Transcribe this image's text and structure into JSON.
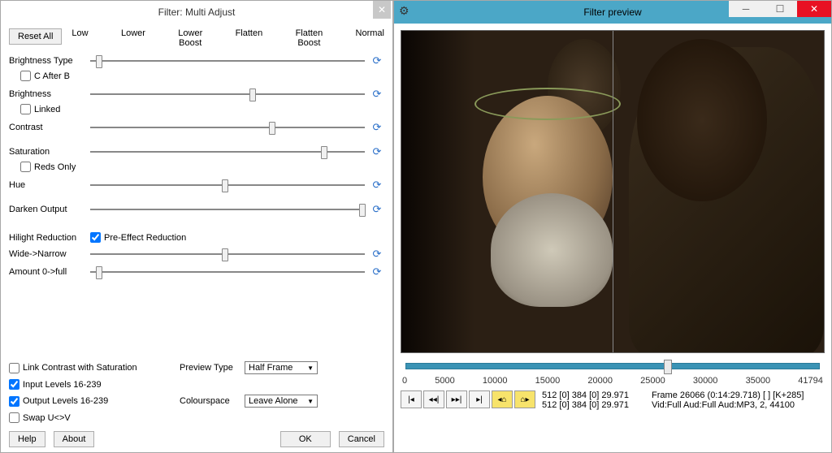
{
  "left_window": {
    "title": "Filter: Multi Adjust",
    "reset_all": "Reset All",
    "radio_labels": [
      "Low",
      "Lower",
      "Lower\nBoost",
      "Flatten",
      "Flatten\nBoost",
      "Normal"
    ],
    "sliders": {
      "brightness_type": {
        "label": "Brightness Type",
        "pos": 2
      },
      "brightness": {
        "label": "Brightness",
        "pos": 58
      },
      "contrast": {
        "label": "Contrast",
        "pos": 65
      },
      "saturation": {
        "label": "Saturation",
        "pos": 84
      },
      "hue": {
        "label": "Hue",
        "pos": 48
      },
      "darken_output": {
        "label": "Darken Output",
        "pos": 98
      },
      "wide_narrow": {
        "label": "Wide->Narrow",
        "pos": 48
      },
      "amount": {
        "label": "Amount 0->full",
        "pos": 2
      }
    },
    "checks": {
      "c_after_b": {
        "label": "C After B",
        "checked": false
      },
      "linked": {
        "label": "Linked",
        "checked": false
      },
      "reds_only": {
        "label": "Reds Only",
        "checked": false
      },
      "pre_effect": {
        "label": "Pre-Effect Reduction",
        "checked": true
      },
      "link_contrast": {
        "label": "Link Contrast with Saturation",
        "checked": false
      },
      "input_levels": {
        "label": "Input Levels 16-239",
        "checked": true
      },
      "output_levels": {
        "label": "Output Levels 16-239",
        "checked": true
      },
      "swap_uv": {
        "label": "Swap U<>V",
        "checked": false
      }
    },
    "hilight_label": "Hilight Reduction",
    "preview_type_label": "Preview Type",
    "preview_type_value": "Half Frame",
    "colourspace_label": "Colourspace",
    "colourspace_value": "Leave Alone",
    "help": "Help",
    "about": "About",
    "ok": "OK",
    "cancel": "Cancel"
  },
  "right_window": {
    "title": "Filter preview",
    "scrub": {
      "ticks": [
        "0",
        "5000",
        "10000",
        "15000",
        "20000",
        "25000",
        "30000",
        "35000",
        "41794"
      ],
      "pos_pct": 62
    },
    "status": {
      "line1a": "512 [0] 384 [0] 29.971",
      "line1b": "Frame 26066 (0:14:29.718) [ ] [K+285]",
      "line2a": "512 [0] 384 [0] 29.971",
      "line2b": "Vid:Full   Aud:Full   Aud:MP3, 2, 44100"
    }
  }
}
